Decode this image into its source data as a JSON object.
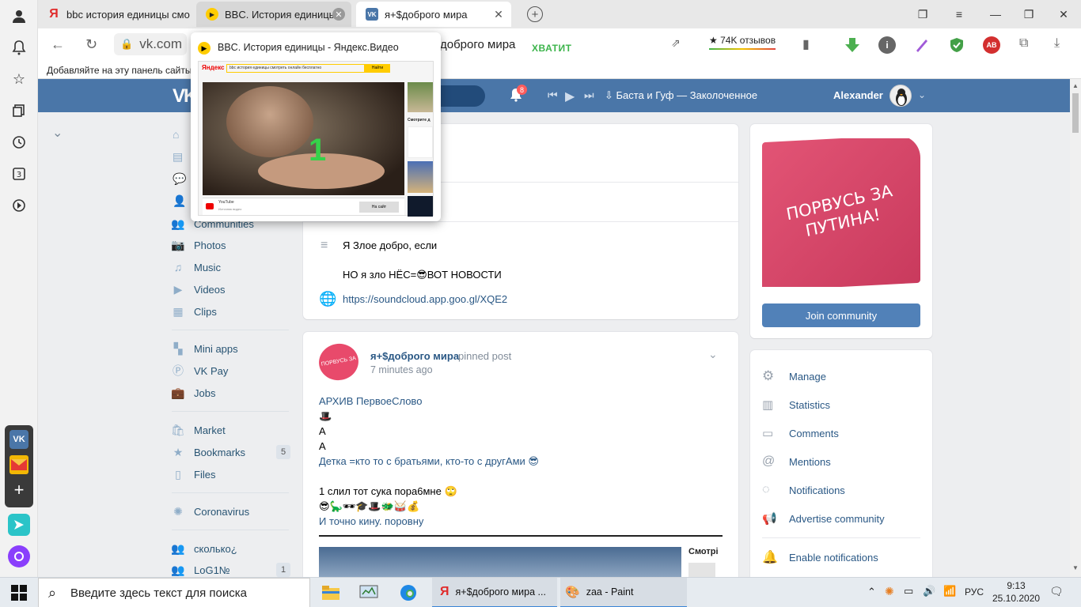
{
  "tabs": [
    {
      "label": "bbc история единицы смо",
      "icon": "yandex-icon"
    },
    {
      "label": "BBC. История единицы",
      "icon": "yandex-video-icon"
    },
    {
      "label": "я+$доброго мира",
      "icon": "vk-icon"
    }
  ],
  "address": {
    "url": "vk.com",
    "page_title": "доброго мира",
    "hvatit": "ХВАТИТ",
    "reviews": "★ 74K отзывов"
  },
  "bookmarks_hint": "Добавляйте на эту панель сайты,",
  "popup": {
    "title": "BBC. История единицы - Яндекс.Видео",
    "search_query": "bbc история единицы смотреть онлайн бесплатно",
    "search_button": "Найти",
    "yandex_logo": "Яндекс",
    "video_digit": "1",
    "source_name": "YouTube",
    "source_sub": "Источник видео",
    "to_site": "На сайт",
    "side_label": "Смотрите д"
  },
  "vk_header": {
    "logo": "VK",
    "bell_count": "8",
    "track": "Баста и Гуф — Заколоченное",
    "username": "Alexander"
  },
  "menu": [
    {
      "label": "Communities",
      "icon": "communities-icon"
    },
    {
      "label": "Photos",
      "icon": "camera-icon"
    },
    {
      "label": "Music",
      "icon": "music-icon"
    },
    {
      "label": "Videos",
      "icon": "video-icon"
    },
    {
      "label": "Clips",
      "icon": "clips-icon"
    },
    {
      "label": "Mini apps",
      "icon": "apps-icon"
    },
    {
      "label": "VK Pay",
      "icon": "pay-icon"
    },
    {
      "label": "Jobs",
      "icon": "briefcase-icon"
    },
    {
      "label": "Market",
      "icon": "bag-icon"
    },
    {
      "label": "Bookmarks",
      "icon": "star-icon",
      "count": "5"
    },
    {
      "label": "Files",
      "icon": "file-icon"
    },
    {
      "label": "Coronavirus",
      "icon": "virus-icon"
    },
    {
      "label": "сколько¿",
      "icon": "group-icon"
    },
    {
      "label": "LoG1№",
      "icon": "group-icon",
      "count": "1"
    }
  ],
  "info": {
    "status_line1": "Я Злое добро, если",
    "status_line2": "НО я зло НЁС=😎ВОТ НОВОСТИ",
    "link": "https://soundcloud.app.goo.gl/XQE2"
  },
  "post": {
    "author": "я+$доброго мира",
    "pinned": "pinned post",
    "time": "7 minutes ago",
    "lines": [
      "АРХИВ ПервоеСлово",
      "🎩",
      "А",
      "А",
      "Детка =кто то с братьями, кто-то с другАми 😎",
      "",
      "1 слил тот сука пора6мне 🙄",
      "😎🦕🕶🎓🎩🐲🥁💰",
      "И точно кину. поровну"
    ],
    "embed_label": "Смотрі"
  },
  "right": {
    "cover_text_1": "ПОРВУСЬ ЗА",
    "cover_text_2": "ПУТИНА!",
    "join": "Join community",
    "actions": [
      {
        "label": "Manage",
        "icon": "gear-icon"
      },
      {
        "label": "Statistics",
        "icon": "stats-icon"
      },
      {
        "label": "Comments",
        "icon": "comment-icon"
      },
      {
        "label": "Mentions",
        "icon": "at-icon"
      },
      {
        "label": "Notifications",
        "icon": "notification-icon"
      },
      {
        "label": "Advertise community",
        "icon": "megaphone-icon"
      },
      {
        "label": "Enable notifications",
        "icon": "bell-icon"
      }
    ]
  },
  "taskbar": {
    "search_placeholder": "Введите здесь текст для поиска",
    "app_yandex": "я+$доброго мира ...",
    "app_paint": "zaa - Paint",
    "lang": "РУС",
    "time": "9:13",
    "date": "25.10.2020"
  },
  "colors": {
    "vk_blue": "#4a76a8",
    "link": "#2a5885",
    "cover_pink": "#e84a6b",
    "join_button": "#5181b8"
  }
}
